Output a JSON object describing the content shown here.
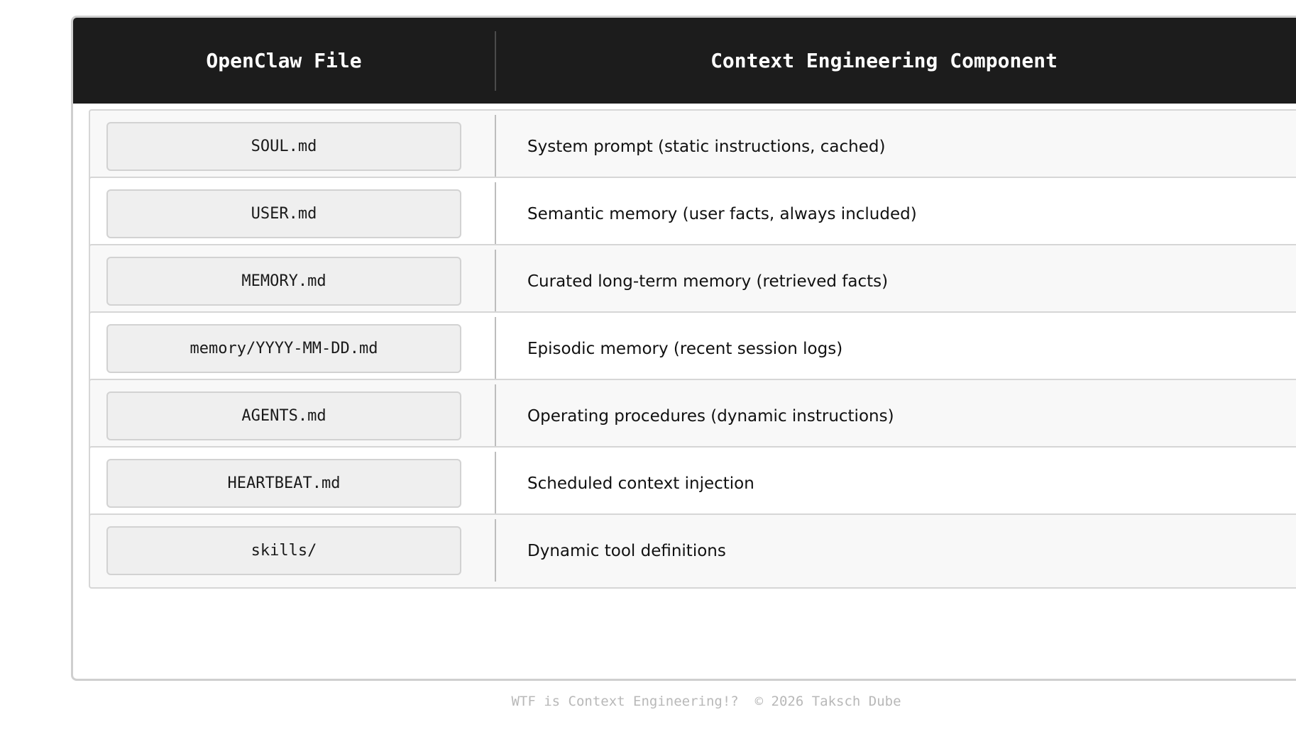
{
  "table": {
    "headers": {
      "file": "OpenClaw File",
      "component": "Context Engineering Component"
    },
    "rows": [
      {
        "file": "SOUL.md",
        "component": "System prompt (static instructions, cached)"
      },
      {
        "file": "USER.md",
        "component": "Semantic memory (user facts, always included)"
      },
      {
        "file": "MEMORY.md",
        "component": "Curated long-term memory (retrieved facts)"
      },
      {
        "file": "memory/YYYY-MM-DD.md",
        "component": "Episodic memory (recent session logs)"
      },
      {
        "file": "AGENTS.md",
        "component": "Operating procedures (dynamic instructions)"
      },
      {
        "file": "HEARTBEAT.md",
        "component": "Scheduled context injection"
      },
      {
        "file": "skills/",
        "component": "Dynamic tool definitions"
      }
    ]
  },
  "footer": {
    "text": "WTF is Context Engineering!?  © 2026 Taksch Dube"
  },
  "colors": {
    "header_bg": "#1c1c1c",
    "header_text": "#ffffff",
    "row_alt_bg": "#f8f8f8",
    "pill_bg": "#efefef",
    "footer_text": "#b8b8b8"
  }
}
